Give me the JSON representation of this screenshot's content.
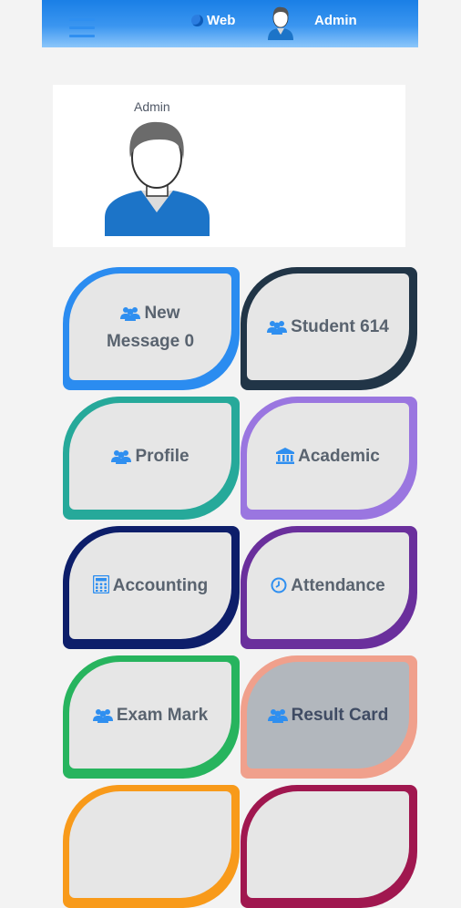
{
  "topbar": {
    "web_label": "Web",
    "user_label": "Admin"
  },
  "profile": {
    "name": "Admin"
  },
  "tiles": [
    {
      "label": "New",
      "label2": "Message 0",
      "icon": "users-icon",
      "border": "#2b8cf0"
    },
    {
      "label": "Student 614",
      "icon": "users-icon",
      "border": "#213547"
    },
    {
      "label": "Profile",
      "icon": "users-icon",
      "border": "#26a99a"
    },
    {
      "label": "Academic",
      "icon": "bank-icon",
      "border": "#9a76e0"
    },
    {
      "label": "Accounting",
      "icon": "calculator-icon",
      "border": "#0d1e6a"
    },
    {
      "label": "Attendance",
      "icon": "clock-icon",
      "border": "#6a2f9c"
    },
    {
      "label": "Exam Mark",
      "icon": "users-icon",
      "border": "#27b45e"
    },
    {
      "label": "Result Card",
      "icon": "users-icon",
      "border": "#f0a08c",
      "fill": "#b2b7bd"
    }
  ]
}
